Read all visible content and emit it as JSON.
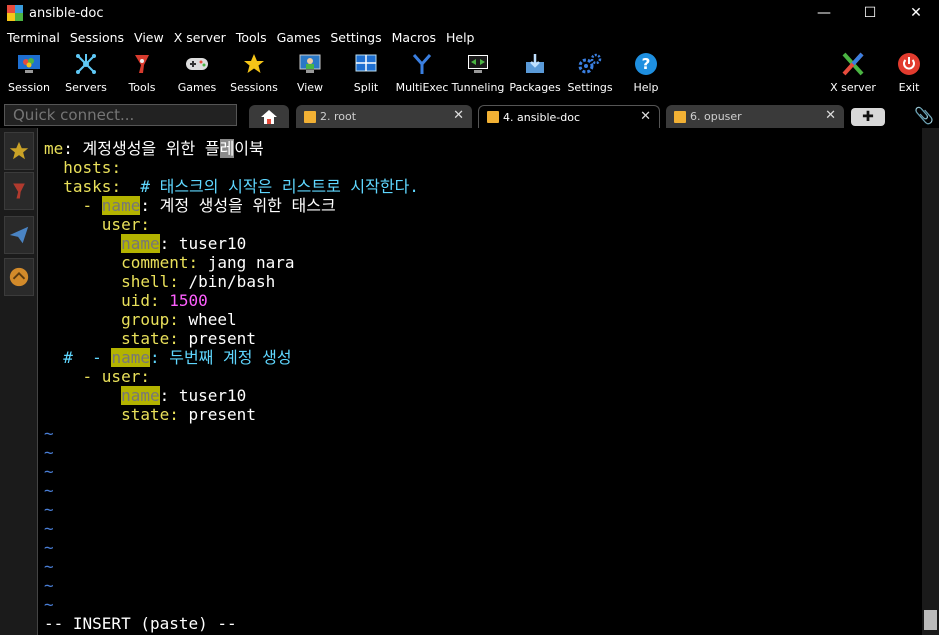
{
  "window": {
    "title": "ansible-doc",
    "minimize": "—",
    "maximize": "☐",
    "close": "✕"
  },
  "menu": [
    "Terminal",
    "Sessions",
    "View",
    "X server",
    "Tools",
    "Games",
    "Settings",
    "Macros",
    "Help"
  ],
  "toolbar": [
    {
      "label": "Session",
      "icon": "session-icon"
    },
    {
      "label": "Servers",
      "icon": "servers-icon"
    },
    {
      "label": "Tools",
      "icon": "tools-icon"
    },
    {
      "label": "Games",
      "icon": "games-icon"
    },
    {
      "label": "Sessions",
      "icon": "sessions-star-icon"
    },
    {
      "label": "View",
      "icon": "view-icon"
    },
    {
      "label": "Split",
      "icon": "split-icon"
    },
    {
      "label": "MultiExec",
      "icon": "multiexec-icon"
    },
    {
      "label": "Tunneling",
      "icon": "tunneling-icon"
    },
    {
      "label": "Packages",
      "icon": "packages-icon"
    },
    {
      "label": "Settings",
      "icon": "settings-gear-icon"
    },
    {
      "label": "Help",
      "icon": "help-icon"
    },
    {
      "label": "X server",
      "icon": "xserver-icon"
    },
    {
      "label": "Exit",
      "icon": "exit-power-icon"
    }
  ],
  "quick_connect": {
    "placeholder": "Quick connect..."
  },
  "tabs": [
    {
      "label": "2. root",
      "active": false
    },
    {
      "label": "4. ansible-doc",
      "active": true
    },
    {
      "label": "6. opuser",
      "active": false
    }
  ],
  "terminal": {
    "l1_key": "me",
    "l1_text": "계정생성을 위한 플",
    "l1_cursor": "레",
    "l1_rest": "이북",
    "l2_key": "hosts",
    "l3_key": "tasks",
    "l3_comment": "# 태스크의 시작은 리스트로 시작한다.",
    "l4_dash": "- ",
    "l4_key": "name",
    "l4_text": "계정 생성을 위한 태스크",
    "l5_key": "user",
    "l6_key": "name",
    "l6_val": "tuser10",
    "l7_key": "comment",
    "l7_val": "jang nara",
    "l8_key": "shell",
    "l8_val": "/bin/bash",
    "l9_key": "uid",
    "l9_val": "1500",
    "l10_key": "group",
    "l10_val": "wheel",
    "l11_key": "state",
    "l11_val": "present",
    "l12_hash": "#  - ",
    "l12_key": "name",
    "l12_text": "두번째 계정 생성",
    "l13_dash": "- ",
    "l13_key": "user",
    "l14_key": "name",
    "l14_val": "tuser10",
    "l15_key": "state",
    "l15_val": "present",
    "tilde": "~",
    "status": "-- INSERT (paste) --"
  }
}
